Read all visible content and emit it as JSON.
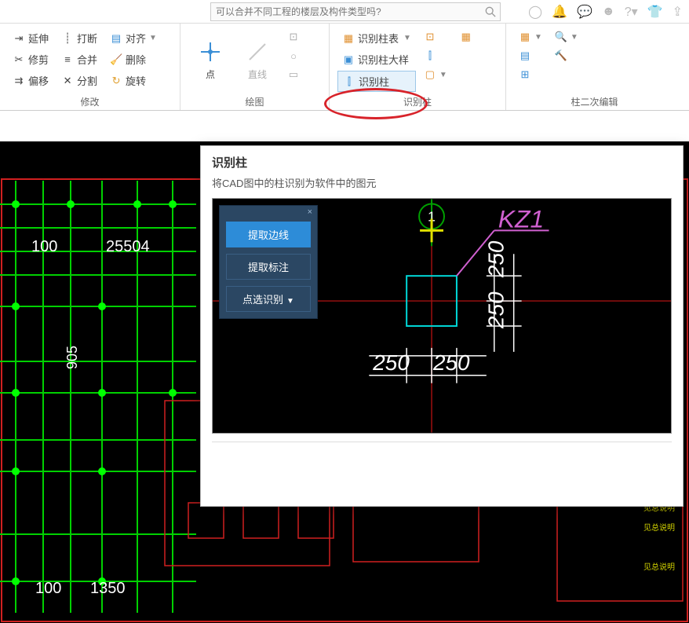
{
  "search": {
    "placeholder": "可以合并不同工程的楼层及构件类型吗?"
  },
  "ribbon": {
    "groups": {
      "modify": {
        "label": "修改",
        "items": {
          "extend": "延伸",
          "break": "打断",
          "align": "对齐",
          "trim": "修剪",
          "merge": "合并",
          "delete": "删除",
          "offset": "偏移",
          "split": "分割",
          "rotate": "旋转"
        }
      },
      "draw": {
        "label": "绘图",
        "items": {
          "point": "点",
          "line": "直线"
        }
      },
      "rec_col": {
        "label": "识别柱",
        "items": {
          "rec_table": "识别柱表",
          "rec_detail": "识别柱大样",
          "rec_col": "识别柱"
        }
      },
      "col_edit": {
        "label": "柱二次编辑"
      }
    }
  },
  "popup": {
    "title": "识别柱",
    "desc": "将CAD图中的柱识别为软件中的图元",
    "panel": {
      "btn1": "提取边线",
      "btn2": "提取标注",
      "btn3": "点选识别"
    },
    "column_label": "KZ1",
    "dims": {
      "d1": "250",
      "d2": "250",
      "d3": "250",
      "d4": "250"
    },
    "bubble": "1"
  },
  "cad": {
    "dim100a": "100",
    "dim100b": "100",
    "dim1350": "1350",
    "dim905": "905",
    "dim2554": "25504"
  }
}
